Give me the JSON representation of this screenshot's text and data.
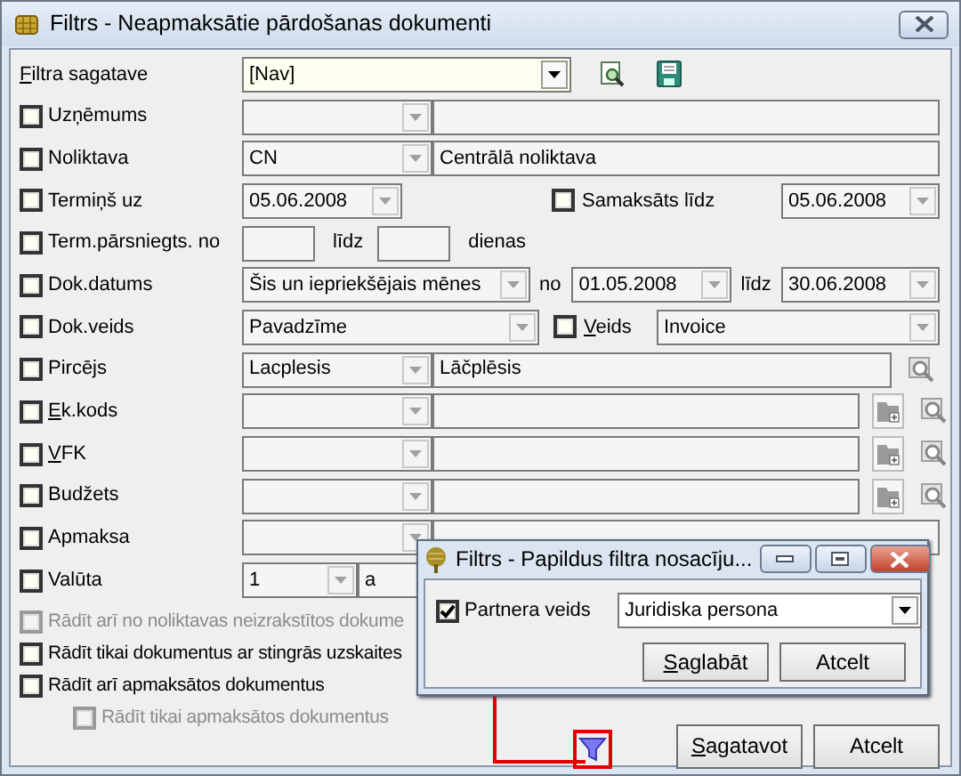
{
  "window": {
    "title": "Filtrs - Neapmaksātie pārdošanas dokumenti"
  },
  "template": {
    "label": "Filtra sagatave",
    "access_key": true,
    "value": "[Nav]"
  },
  "filters": [
    {
      "kind": "lookup",
      "label": "Uzņēmums",
      "checked": false
    },
    {
      "kind": "lookup",
      "label": "Noliktava",
      "checked": false,
      "code": "CN",
      "name": "Centrālā noliktava"
    },
    {
      "kind": "due",
      "label": "Termiņš uz",
      "checked": false,
      "date": "05.06.2008",
      "second_label": "Samaksāts līdz",
      "second_checked": false,
      "second_date": "05.06.2008"
    },
    {
      "kind": "range",
      "label": "Term.pārsniegts. no",
      "checked": false,
      "to_label": "līdz",
      "unit": "dienas"
    },
    {
      "kind": "period",
      "label": "Dok.datums",
      "checked": false,
      "period": "Šis un iepriekšējais mēnes",
      "from_label": "no",
      "from": "01.05.2008",
      "to_label": "līdz",
      "to": "30.06.2008"
    },
    {
      "kind": "doc_type",
      "label": "Dok.veids",
      "checked": false,
      "value": "Pavadzīme",
      "second_label": "Veids",
      "second_access_key": true,
      "second_checked": false,
      "second_value": "Invoice"
    },
    {
      "kind": "lookup_search",
      "label": "Pircējs",
      "checked": false,
      "code": "Lacplesis",
      "name": "Lāčplēsis"
    },
    {
      "kind": "lookup_tools",
      "label": "Ek.kods",
      "access_key": true,
      "checked": false
    },
    {
      "kind": "lookup_tools",
      "label": "VFK",
      "access_key": true,
      "checked": false
    },
    {
      "kind": "lookup_tools",
      "label": "Budžets",
      "checked": false
    },
    {
      "kind": "lookup",
      "label": "Apmaksa",
      "checked": false
    },
    {
      "kind": "currency",
      "label": "Valūta",
      "checked": false,
      "code": "1",
      "name": "a"
    }
  ],
  "options": [
    {
      "label": "Rādīt arī no noliktavas neizrakstītos dokume",
      "checked": false,
      "disabled": true,
      "indented": false
    },
    {
      "label": "Rādīt tikai dokumentus ar stingrās uzskaites",
      "checked": false,
      "disabled": false,
      "indented": false
    },
    {
      "label": "Rādīt arī apmaksātos dokumentus",
      "checked": false,
      "disabled": false,
      "indented": false
    },
    {
      "label": "Rādīt tikai apmaksātos dokumentus",
      "checked": false,
      "disabled": true,
      "indented": true
    }
  ],
  "filter_button": {
    "highlighted": true
  },
  "buttons": [
    {
      "label": "Sagatavot",
      "access_key": true
    },
    {
      "label": "Atcelt",
      "access_key": false
    }
  ],
  "popup": {
    "title": "Filtrs - Papildus filtra nosacīju...",
    "field": {
      "label": "Partnera veids",
      "checked": true,
      "value": "Juridiska persona"
    },
    "buttons": [
      {
        "label": "Saglabāt",
        "access_key": true
      },
      {
        "label": "Atcelt",
        "access_key": false
      }
    ]
  }
}
